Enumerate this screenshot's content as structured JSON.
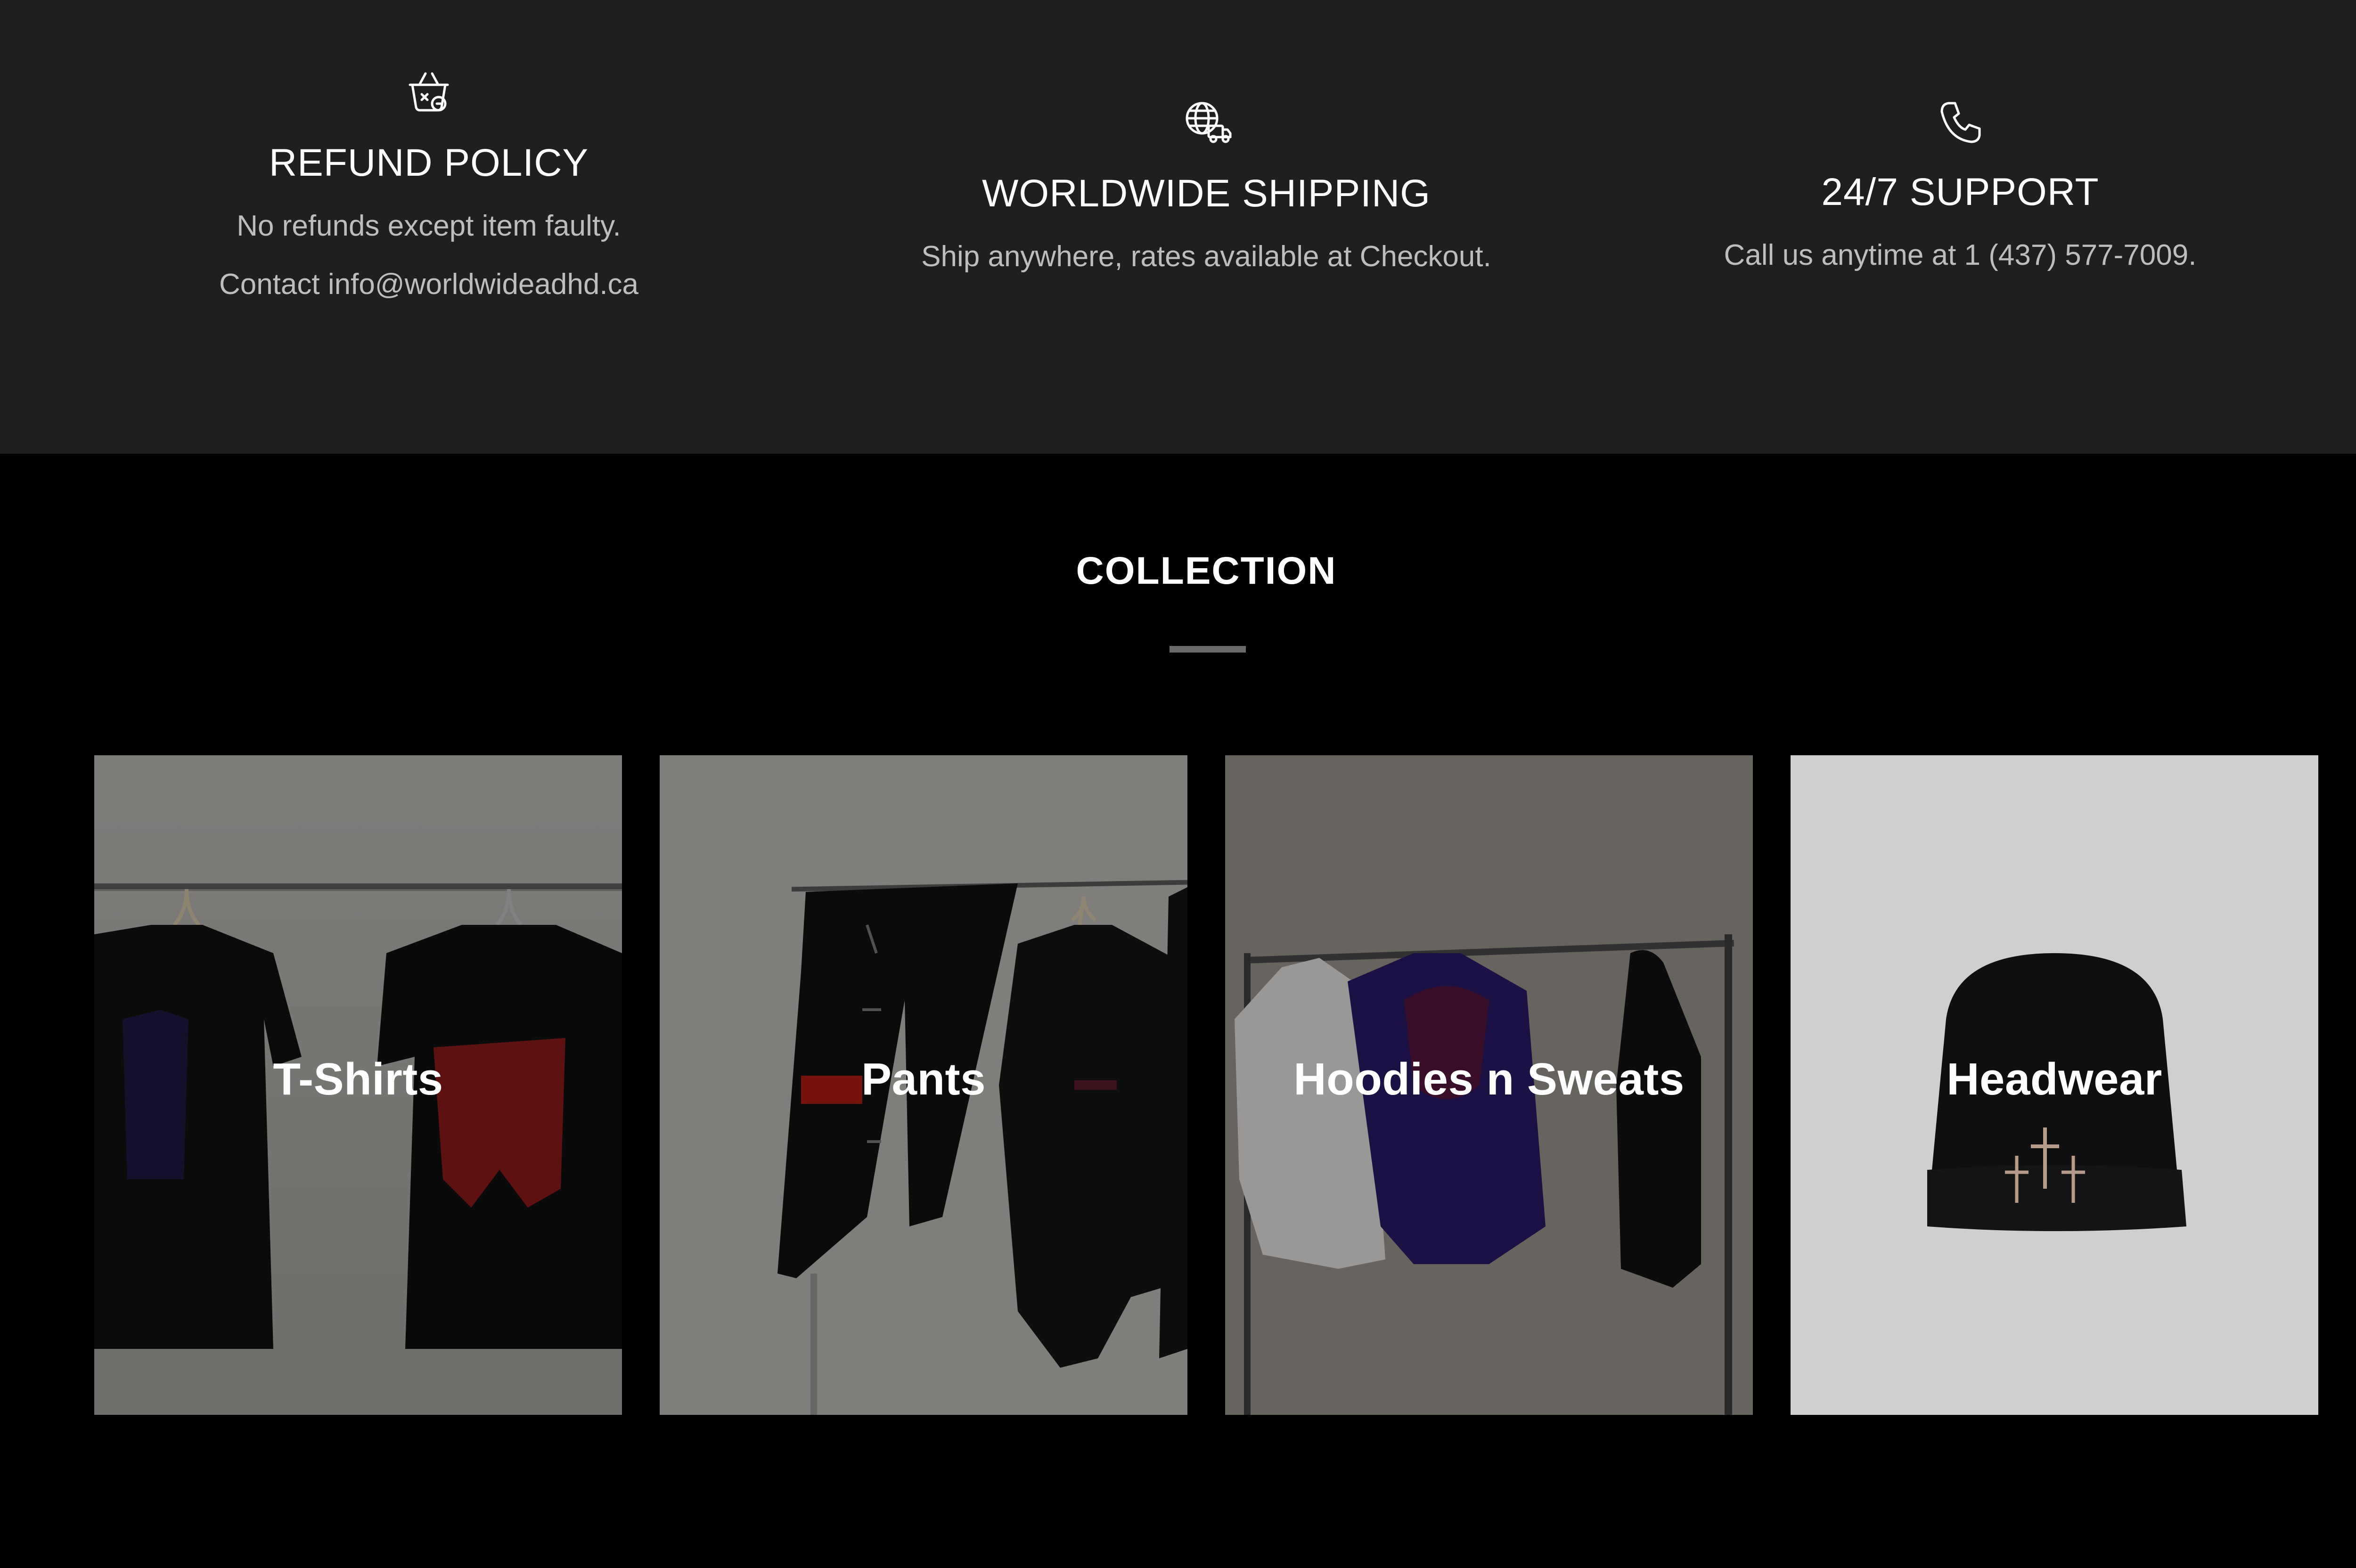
{
  "features": {
    "refund": {
      "icon": "basket-cancel-icon",
      "title": "REFUND POLICY",
      "line1": "No refunds except item faulty.",
      "line2": "Contact info@worldwideadhd.ca"
    },
    "shipping": {
      "icon": "globe-truck-icon",
      "title": "WORLDWIDE SHIPPING",
      "line1": "Ship anywhere, rates available at Checkout."
    },
    "support": {
      "icon": "phone-icon",
      "title": "24/7 SUPPORT",
      "line1": "Call us anytime at 1 (437) 577-7009."
    }
  },
  "collection": {
    "title": "COLLECTION",
    "cards": [
      {
        "label": "T-Shirts"
      },
      {
        "label": "Pants"
      },
      {
        "label": "Hoodies n Sweats"
      },
      {
        "label": "Headwear"
      }
    ]
  },
  "colors": {
    "features_bg": "#1f1f1f",
    "page_bg": "#000000",
    "text_primary": "#ffffff",
    "text_secondary": "#bdbdbd",
    "divider": "#6b6b6b"
  }
}
